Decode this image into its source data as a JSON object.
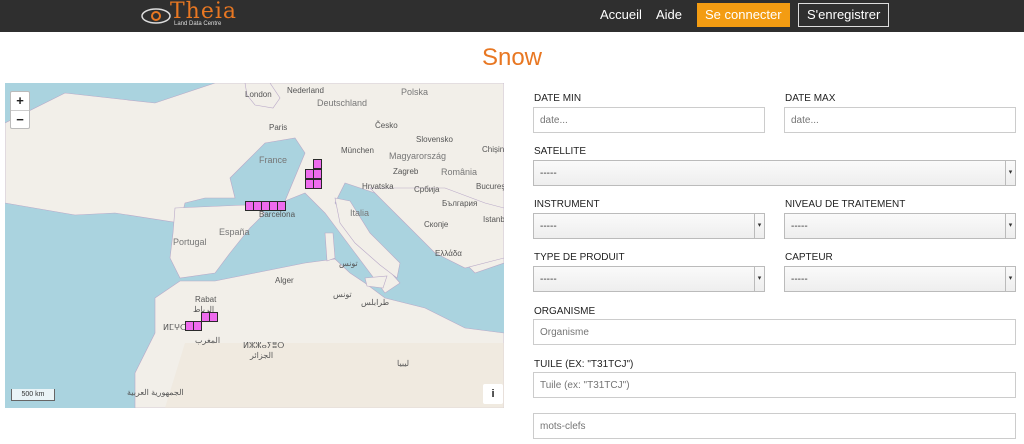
{
  "header": {
    "logo_text": "Theia",
    "logo_sub": "Land Data Centre",
    "nav": [
      "Accueil",
      "Aide"
    ],
    "connect": "Se connecter",
    "register": "S'enregistrer"
  },
  "page_title": "Snow",
  "map": {
    "zoom_in": "+",
    "zoom_out": "−",
    "scale": "500 km",
    "info": "i",
    "labels": {
      "nederland": "Nederland",
      "london": "London",
      "polska": "Polska",
      "deutschland": "Deutschland",
      "cesko": "Česko",
      "paris": "Paris",
      "slovensko": "Slovensko",
      "chisina": "Chișinău",
      "munchen": "München",
      "france": "France",
      "magyarorszag": "Magyarország",
      "zagreb": "Zagreb",
      "romania": "România",
      "hrvatska": "Hrvatska",
      "srbija": "Србија",
      "bucure": "Bucureşti",
      "bulgaria": "България",
      "istanb": "Istanbul",
      "barcelona": "Barcelona",
      "espana": "España",
      "italia": "Italia",
      "skopje": "Скопје",
      "portugal": "Portugal",
      "ellada": "Ελλάδα",
      "tunis": "تونس",
      "rabat": "Rabat",
      "rabat_ar": "الرباط",
      "alger": "Alger",
      "tunis2": "تونس",
      "tarabulus": "طرابلس",
      "almaghrib": "المغرب",
      "algeria_tif": "ⵍⵣⵣⴰⵢⴻⵔ",
      "algeria_ar": "الجزائر",
      "libya": "ليبيا",
      "sahara": "الجمهورية العربية",
      "morocco_tif": "ⵍⵎⵖⵔⵉⴱ"
    },
    "colors": {
      "sea": "#aad3df",
      "land": "#f2efe9",
      "tile": "#ee6bee"
    }
  },
  "form": {
    "date_min_label": "DATE MIN",
    "date_min_placeholder": "date...",
    "date_max_label": "DATE MAX",
    "date_max_placeholder": "date...",
    "satellite_label": "SATELLITE",
    "satellite_value": "-----",
    "instrument_label": "INSTRUMENT",
    "instrument_value": "-----",
    "niveau_label": "NIVEAU DE TRAITEMENT",
    "niveau_value": "-----",
    "type_label": "TYPE DE PRODUIT",
    "type_value": "-----",
    "capteur_label": "CAPTEUR",
    "capteur_value": "-----",
    "organisme_label": "ORGANISME",
    "organisme_placeholder": "Organisme",
    "tuile_label": "TUILE (EX: \"T31TCJ\")",
    "tuile_placeholder": "Tuile (ex: \"T31TCJ\")",
    "mots_placeholder": "mots-clefs"
  }
}
